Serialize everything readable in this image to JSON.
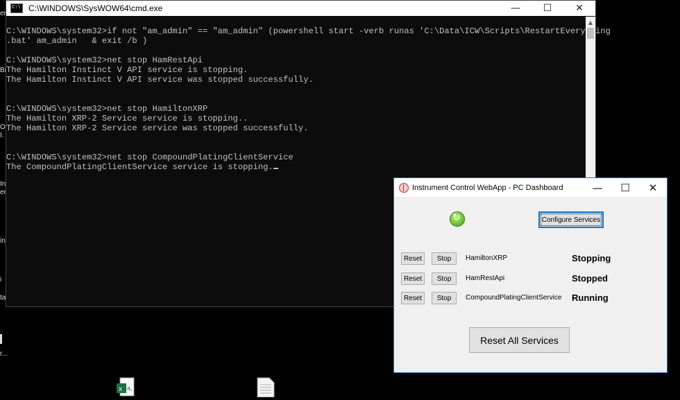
{
  "desktop": {
    "fragments": [
      "er",
      "Bi",
      "Of",
      "I.",
      "In",
      "er",
      "in",
      "i",
      "ta",
      "r..."
    ]
  },
  "cmd": {
    "title": "C:\\WINDOWS\\SysWOW64\\cmd.exe",
    "lines": [
      "C:\\WINDOWS\\system32>if not \"am_admin\" == \"am_admin\" (powershell start -verb runas 'C:\\Data\\ICW\\Scripts\\RestartEverything",
      ".bat' am_admin   & exit /b )",
      "",
      "C:\\WINDOWS\\system32>net stop HamRestApi",
      "The Hamilton Instinct V API service is stopping.",
      "The Hamilton Instinct V API service was stopped successfully.",
      "",
      "",
      "C:\\WINDOWS\\system32>net stop HamiltonXRP",
      "The Hamilton XRP-2 Service service is stopping..",
      "The Hamilton XRP-2 Service service was stopped successfully.",
      "",
      "",
      "C:\\WINDOWS\\system32>net stop CompoundPlatingClientService",
      "The CompoundPlatingClientService service is stopping."
    ]
  },
  "dashboard": {
    "title": "Instrument Control WebApp - PC Dashboard",
    "configure_label": "Configure Services",
    "reset_label": "Reset",
    "stop_label": "Stop",
    "services": [
      {
        "name": "HamiltonXRP",
        "status": "Stopping"
      },
      {
        "name": "HamRestApi",
        "status": "Stopped"
      },
      {
        "name": "CompoundPlatingClientService",
        "status": "Running"
      }
    ],
    "reset_all_label": "Reset All Services"
  }
}
